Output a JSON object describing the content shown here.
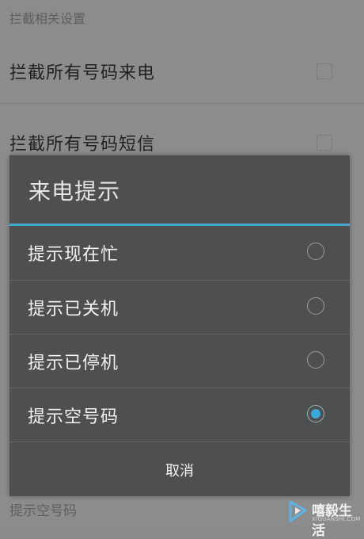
{
  "settings": {
    "section_header": "拦截相关设置",
    "rows": [
      {
        "label": "拦截所有号码来电"
      },
      {
        "label": "拦截所有号码短信"
      }
    ],
    "bottom_label": "提示空号码"
  },
  "dialog": {
    "title": "来电提示",
    "options": [
      {
        "label": "提示现在忙",
        "selected": false
      },
      {
        "label": "提示已关机",
        "selected": false
      },
      {
        "label": "提示已停机",
        "selected": false
      },
      {
        "label": "提示空号码",
        "selected": true
      }
    ],
    "cancel_label": "取消"
  },
  "watermark": {
    "text": "嘻毅生活",
    "subtext": "XIGUANSHI.COM"
  },
  "colors": {
    "accent": "#45a6cf",
    "radio_selected": "#3aa8dd",
    "dialog_bg": "#4f4f4f",
    "scrim_bg": "#8c8c8c"
  }
}
